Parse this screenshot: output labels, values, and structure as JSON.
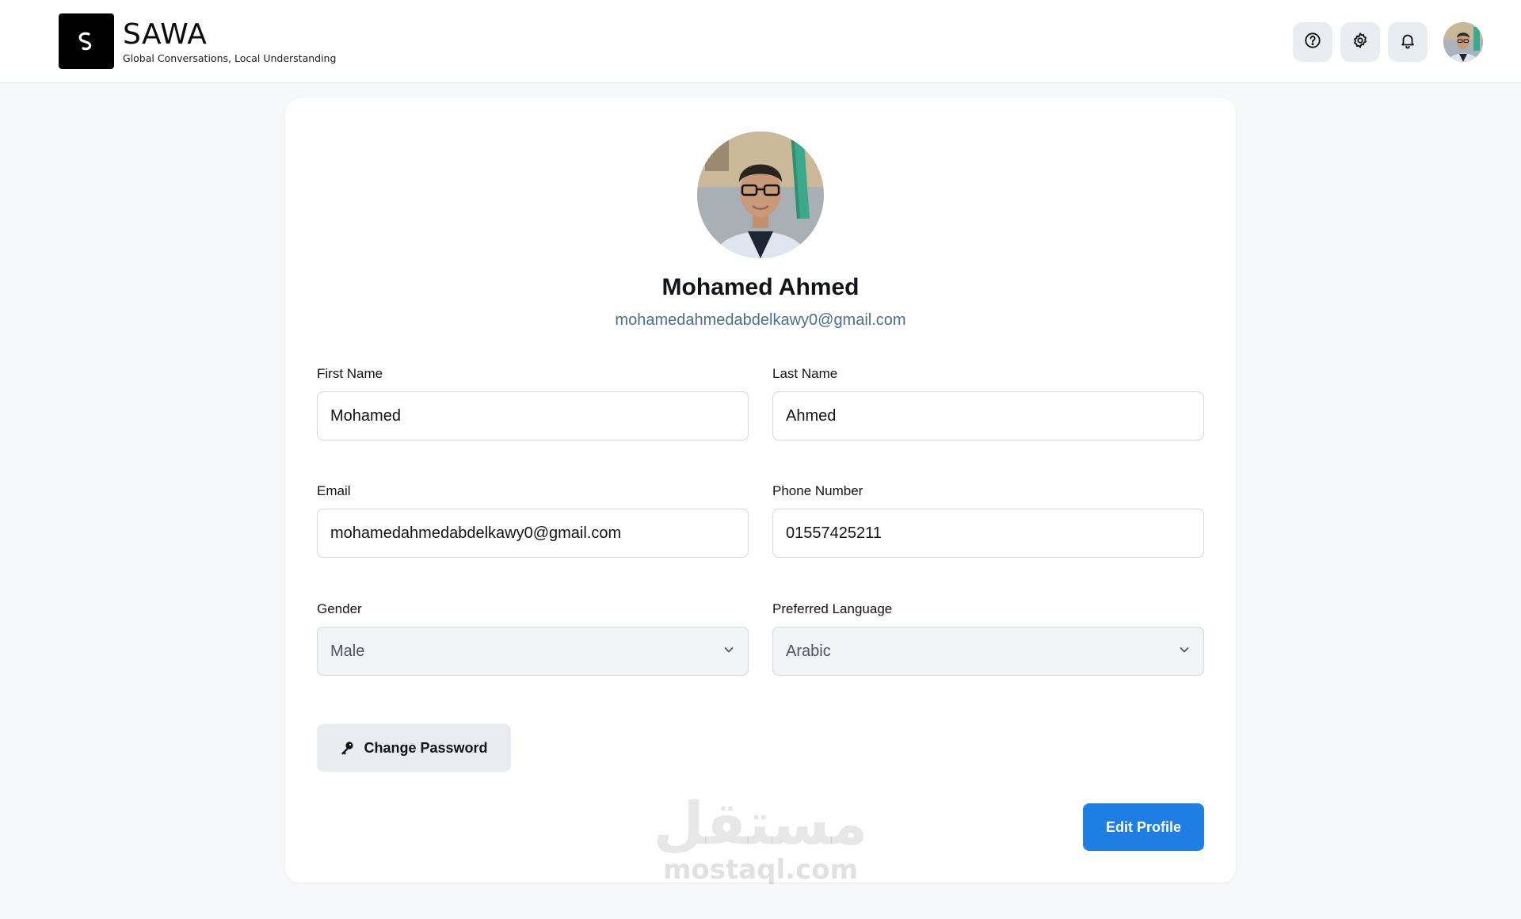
{
  "header": {
    "brand_name": "SAWA",
    "brand_tagline": "Global Conversations, Local Understanding",
    "actions": [
      "help-icon",
      "gear-icon",
      "bell-icon",
      "user-avatar"
    ]
  },
  "profile": {
    "name": "Mohamed Ahmed",
    "email": "mohamedahmedabdelkawy0@gmail.com"
  },
  "form": {
    "first_name": {
      "label": "First Name",
      "value": "Mohamed"
    },
    "last_name": {
      "label": "Last Name",
      "value": "Ahmed"
    },
    "email": {
      "label": "Email",
      "value": "mohamedahmedabdelkawy0@gmail.com"
    },
    "phone": {
      "label": "Phone Number",
      "value": "01557425211"
    },
    "gender": {
      "label": "Gender",
      "value": "Male"
    },
    "language": {
      "label": "Preferred Language",
      "value": "Arabic"
    }
  },
  "buttons": {
    "change_password": "Change Password",
    "edit_profile": "Edit Profile"
  },
  "watermark": {
    "arabic": "مستقل",
    "latin": "mostaql.com"
  },
  "colors": {
    "accent": "#1e7ee4",
    "email_link": "#4a6f8f",
    "icon_button_bg": "#e9edf2"
  }
}
